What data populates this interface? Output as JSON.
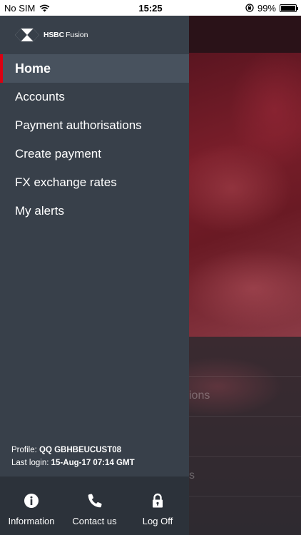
{
  "status_bar": {
    "carrier": "No SIM",
    "time": "15:25",
    "battery_percent": "99%",
    "battery_level": 0.99,
    "icons": [
      "wifi-icon",
      "rotation-lock-icon",
      "battery-icon"
    ]
  },
  "brand": {
    "name": "HSBC",
    "product": "Fusion",
    "accent_color": "#db0011"
  },
  "menu": {
    "items": [
      {
        "label": "Home",
        "active": true
      },
      {
        "label": "Accounts",
        "active": false
      },
      {
        "label": "Payment authorisations",
        "active": false
      },
      {
        "label": "Create payment",
        "active": false
      },
      {
        "label": "FX exchange rates",
        "active": false
      },
      {
        "label": "My alerts",
        "active": false
      }
    ]
  },
  "profile": {
    "profile_label": "Profile:",
    "profile_value": "QQ GBHBEUCUST08",
    "last_login_label": "Last login:",
    "last_login_value": "15-Aug-17 07:14 GMT"
  },
  "bottom_bar": {
    "items": [
      {
        "label": "Information",
        "icon": "info-icon"
      },
      {
        "label": "Contact us",
        "icon": "phone-icon"
      },
      {
        "label": "Log Off",
        "icon": "lock-icon"
      }
    ]
  },
  "background_app": {
    "row1_partial": "ions",
    "row2_partial": "s"
  }
}
